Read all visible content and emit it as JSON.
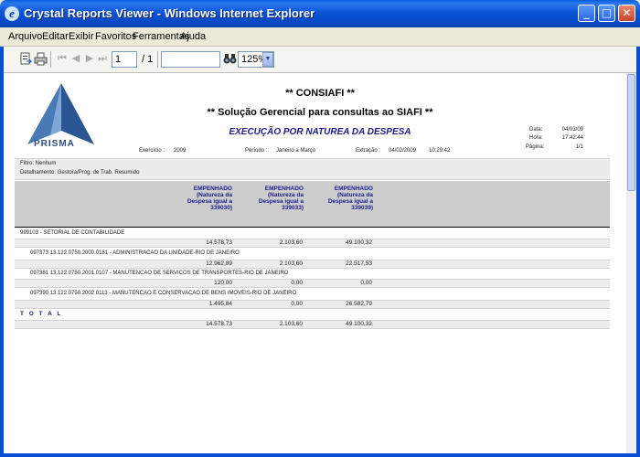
{
  "window": {
    "title": "Crystal Reports Viewer - Windows Internet Explorer",
    "icon": "ie-icon",
    "controls": {
      "minimize": "_",
      "maximize": "□",
      "close": "✕"
    }
  },
  "menu": [
    "Arquivo",
    "Editar",
    "Exibir",
    "Favoritos",
    "Ferramentas",
    "Ajuda"
  ],
  "toolbar": {
    "page_value": "1",
    "page_total": "/ 1",
    "search_value": "",
    "zoom": "125%"
  },
  "report": {
    "logo_text": "PRISMA",
    "title1": "** CONSIAFI **",
    "title2": "** Solução Gerencial para consultas ao SIAFI **",
    "subtitle": "EXECUÇÃO POR NATUREA DA DESPESA",
    "meta": {
      "data_label": "Data:",
      "data_value": "04/03/09",
      "hora_label": "Hora:",
      "hora_value": "17:42:44",
      "pagina_label": "Página:",
      "pagina_value": "1/1"
    },
    "exercicio_label": "Exercício :",
    "exercicio_value": "2009",
    "periodo_label": "Período :",
    "periodo_value": "Janeiro a Março",
    "extracao_label": "Extração :",
    "extracao_date": "04/02/2009",
    "extracao_time": "10:29:42",
    "filtro": "Filtro: Nenhum",
    "detalhamento": "Detalhamento:  Gestora/Prog. de Trab. Resumido",
    "columns": [
      [
        "EMPENHADO",
        "(Natureza da",
        "Despesa igual a",
        "339030)"
      ],
      [
        "EMPENHADO",
        "(Natureza da",
        "Despesa igual a",
        "339033)"
      ],
      [
        "EMPENHADO",
        "(Natureza da",
        "Despesa igual a",
        "339039)"
      ]
    ],
    "rows": [
      {
        "label": "999103 - SETORIAL DE CONTABILIDADE",
        "values": [
          "14.578,73",
          "2.103,60",
          "49.100,32"
        ]
      },
      {
        "label": "097373 13.122.0750.2000.0181 - ADMINISTRACAO DA UNIDADE-RIO DE JANEIRO",
        "values": [
          "12.962,89",
          "2.103,60",
          "22.517,53"
        ]
      },
      {
        "label": "097381 13.122.0750.2001.0107 - MANUTENCAO DE SERVICOS DE TRANSPORTES-RIO DE JANEIRO",
        "values": [
          "120,00",
          "0,00",
          "0,00"
        ]
      },
      {
        "label": "097390 13.122.0750.2002.0113 - MANUTENCAO E CONSERVACAO DE BENS IMOVEIS-RIO DE JANEIRO",
        "values": [
          "1.495,84",
          "0,00",
          "26.582,79"
        ]
      }
    ],
    "total_label": "T O T A L",
    "total_values": [
      "14.578,73",
      "2.103,60",
      "49.100,32"
    ]
  }
}
